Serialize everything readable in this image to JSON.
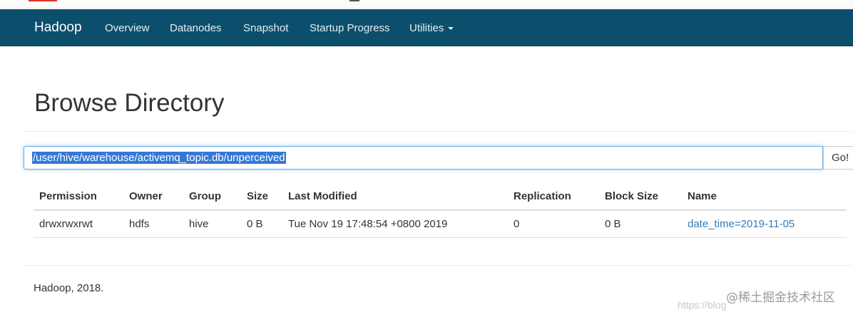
{
  "navbar": {
    "brand": "Hadoop",
    "items": [
      {
        "label": "Overview"
      },
      {
        "label": "Datanodes"
      },
      {
        "label": "Snapshot"
      },
      {
        "label": "Startup Progress"
      },
      {
        "label": "Utilities"
      }
    ],
    "bg_color": "#0b4f6c"
  },
  "page": {
    "title": "Browse Directory"
  },
  "search": {
    "path_value": "/user/hive/warehouse/activemq_topic.db/unperceived",
    "go_label": "Go!"
  },
  "table": {
    "headers": [
      "Permission",
      "Owner",
      "Group",
      "Size",
      "Last Modified",
      "Replication",
      "Block Size",
      "Name"
    ],
    "rows": [
      [
        "drwxrwxrwt",
        "hdfs",
        "hive",
        "0 B",
        "Tue Nov 19 17:48:54 +0800 2019",
        "0",
        "0 B",
        "date_time=2019-11-05"
      ]
    ],
    "link_color": "#337ab7"
  },
  "footer": {
    "text": "Hadoop, 2018."
  },
  "watermark": {
    "text": "@稀土掘金技术社区",
    "url_fragment": "https://blog"
  }
}
